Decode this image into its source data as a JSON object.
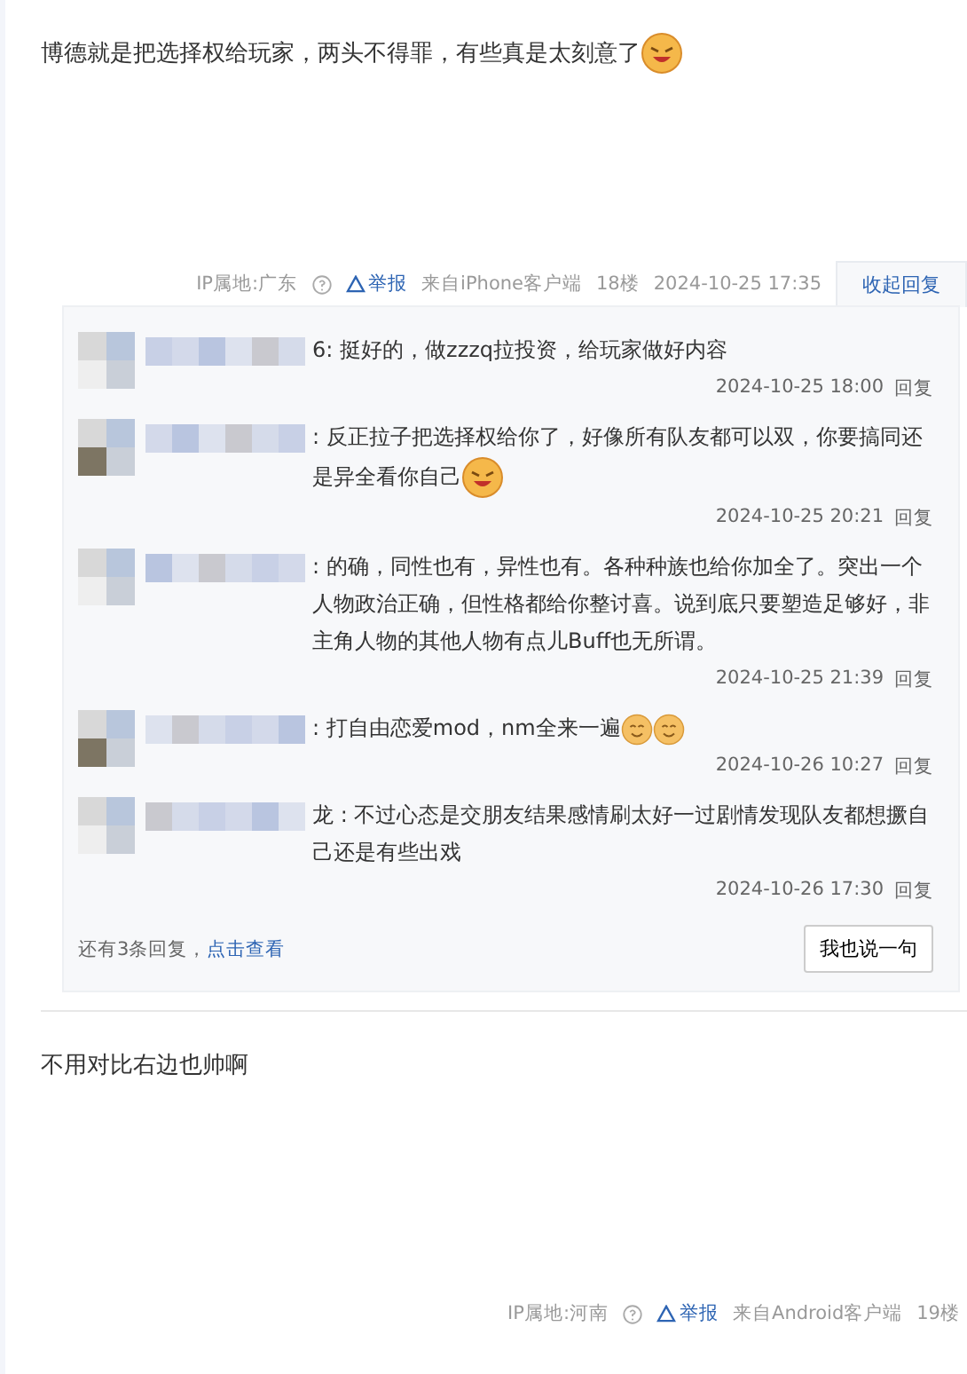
{
  "posts": [
    {
      "text": "博德就是把选择权给玩家，两头不得罪，有些真是太刻意了",
      "emojis": [
        {
          "kind": "grin"
        }
      ],
      "meta": {
        "ip": "IP属地:广东",
        "report": "举报",
        "source": "来自iPhone客户端",
        "floor": "18楼",
        "time": "2024-10-25 17:35",
        "toggle": "收起回复"
      },
      "replies": {
        "items": [
          {
            "name_tail": "6:",
            "text": "挺好的，做zzzq拉投资，给玩家做好内容",
            "time": "2024-10-25 18:00",
            "reply": "回复"
          },
          {
            "name_tail": ":",
            "text": "反正拉子把选择权给你了，好像所有队友都可以双，你要搞同还是异全看你自己",
            "emojis": [
              {
                "kind": "grin"
              }
            ],
            "time": "2024-10-25 20:21",
            "reply": "回复"
          },
          {
            "name_tail": ":",
            "text": "的确，同性也有，异性也有。各种种族也给你加全了。突出一个人物政治正确，但性格都给你整讨喜。说到底只要塑造足够好，非主角人物的其他人物有点儿Buff也无所谓。",
            "time": "2024-10-25 21:39",
            "reply": "回复"
          },
          {
            "name_tail": ":",
            "text": "打自由恋爱mod，nm全来一遍",
            "emojis": [
              {
                "kind": "smile"
              },
              {
                "kind": "smile"
              }
            ],
            "time": "2024-10-26 10:27",
            "reply": "回复"
          },
          {
            "name_tail": "龙 :",
            "text": "不过心态是交朋友结果感情刷太好一过剧情发现队友都想撅自己还是有些出戏",
            "time": "2024-10-26 17:30",
            "reply": "回复"
          }
        ],
        "more": "还有3条回复，",
        "more_link": "点击查看",
        "say": "我也说一句"
      }
    },
    {
      "text": "不用对比右边也帅啊",
      "meta": {
        "ip": "IP属地:河南",
        "report": "举报",
        "source": "来自Android客户端",
        "floor": "19楼"
      }
    }
  ]
}
